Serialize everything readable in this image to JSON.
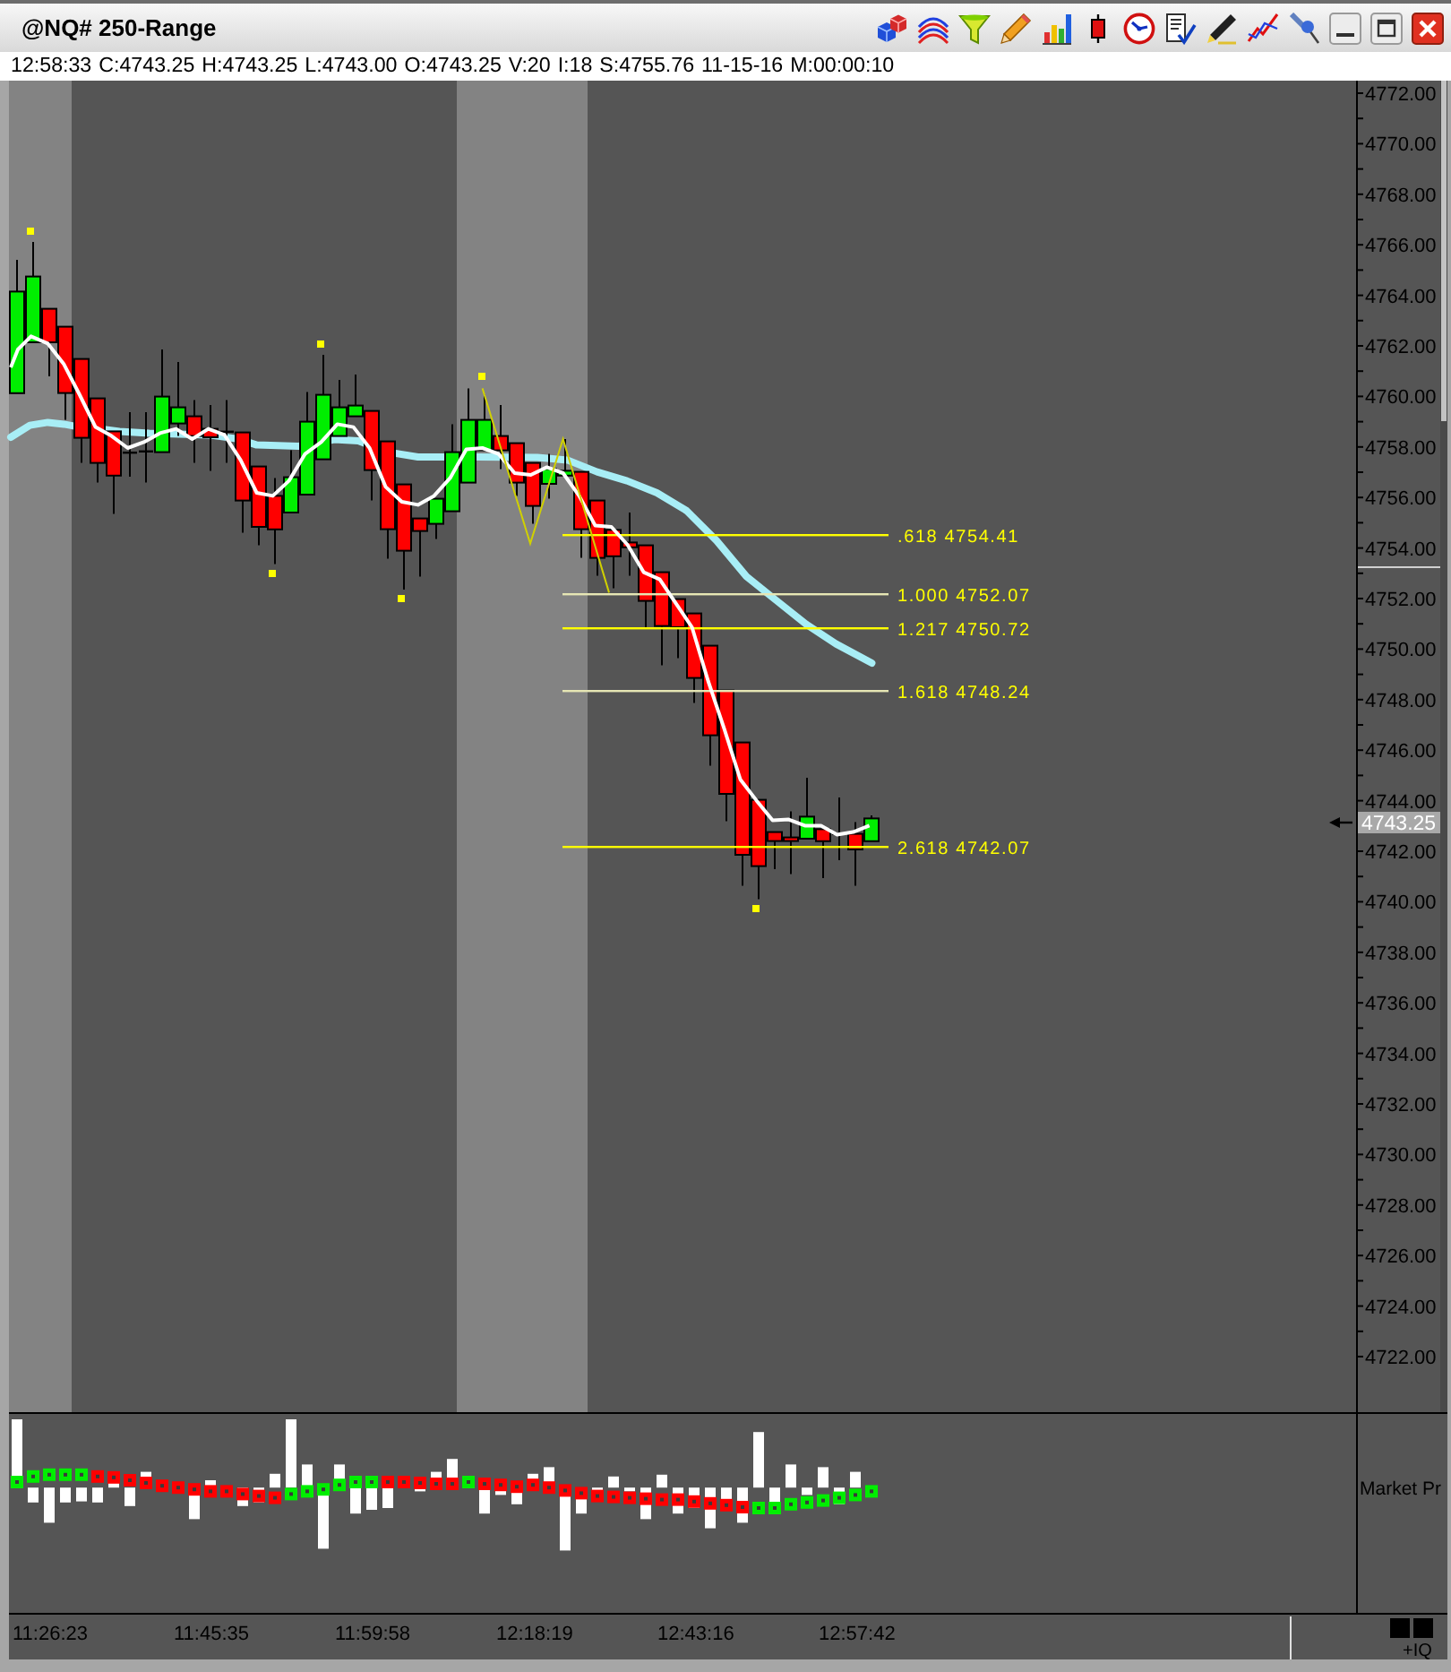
{
  "window": {
    "title": "@NQ# 250-Range"
  },
  "quote_line": [
    "12:58:33",
    "C:4743.25",
    "H:4743.25",
    "L:4743.00",
    "O:4743.25",
    "V:20",
    "I:18",
    "S:4755.76",
    "11-15-16",
    "M:00:00:10"
  ],
  "price_chart": {
    "price_labels": [
      "4772.00",
      "4770.00",
      "4768.00",
      "4766.00",
      "4764.00",
      "4762.00",
      "4760.00",
      "4758.00",
      "4756.00",
      "4754.00",
      "4752.00",
      "4750.00",
      "4748.00",
      "4746.00",
      "4744.00",
      "4742.00",
      "4740.00",
      "4738.00",
      "4736.00",
      "4734.00",
      "4732.00",
      "4730.00",
      "4728.00",
      "4726.00",
      "4724.00",
      "4722.00"
    ],
    "last_price": "4743.25",
    "fib_levels": [
      {
        "label": ".618 4754.41",
        "color": "#ffff00"
      },
      {
        "label": "1.000 4752.07",
        "color": "#e6e6b4"
      },
      {
        "label": "1.217 4750.72",
        "color": "#ffff00"
      },
      {
        "label": "1.618 4748.24",
        "color": "#e6e6b4"
      },
      {
        "label": "2.618 4742.07",
        "color": "#ffff00"
      }
    ]
  },
  "indicator_panel": {
    "label": "Market Pr"
  },
  "time_axis": {
    "labels": [
      "11:26:23",
      "11:45:35",
      "11:59:58",
      "12:18:19",
      "12:43:16",
      "12:57:42"
    ]
  },
  "corner_label": "+IQ"
}
